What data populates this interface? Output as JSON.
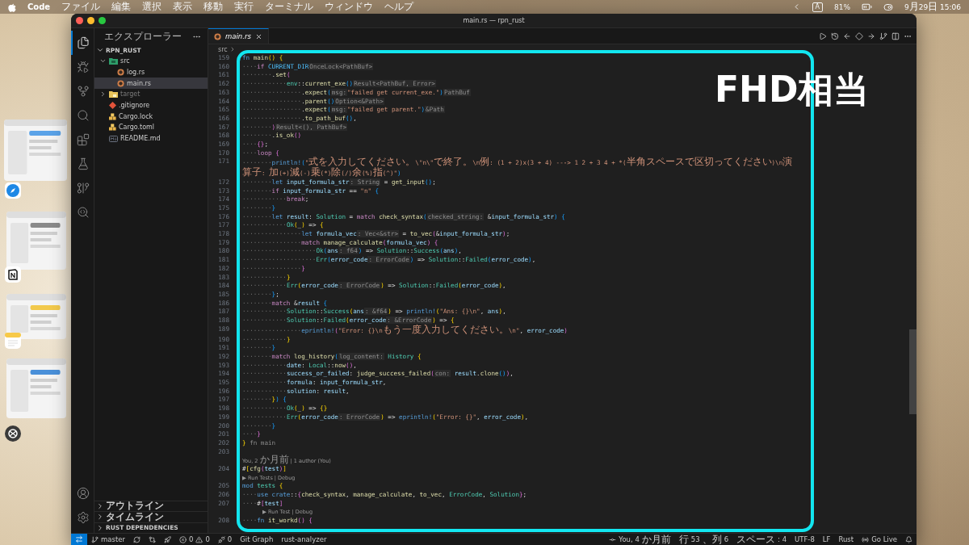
{
  "menubar": {
    "menus": [
      {
        "label": "Code",
        "bold": true
      },
      {
        "label": "ファイル",
        "bold": false
      },
      {
        "label": "編集",
        "bold": false
      },
      {
        "label": "選択",
        "bold": false
      },
      {
        "label": "表示",
        "bold": false
      },
      {
        "label": "移動",
        "bold": false
      },
      {
        "label": "実行",
        "bold": false
      },
      {
        "label": "ターミナル",
        "bold": false
      },
      {
        "label": "ウィンドウ",
        "bold": false
      },
      {
        "label": "ヘルプ",
        "bold": false
      }
    ],
    "input_source": "A",
    "battery": "81%",
    "clock": "9月29日 15:06"
  },
  "stage_manager": [
    {
      "kind": "safari"
    },
    {
      "kind": "notion"
    },
    {
      "kind": "notes"
    },
    {
      "kind": "chatgpt"
    }
  ],
  "window": {
    "title": "main.rs — rpn_rust"
  },
  "activity_bar": {
    "items": [
      {
        "kind": "explorer",
        "selected": true
      },
      {
        "kind": "run",
        "selected": false
      },
      {
        "kind": "scm",
        "selected": false
      },
      {
        "kind": "search",
        "selected": false
      },
      {
        "kind": "extensions",
        "selected": false
      },
      {
        "kind": "testing",
        "selected": false
      },
      {
        "kind": "gitgraph",
        "selected": false
      },
      {
        "kind": "remote",
        "selected": false
      }
    ],
    "bottom": [
      {
        "kind": "account"
      },
      {
        "kind": "settings"
      }
    ]
  },
  "explorer": {
    "title": "エクスプローラー",
    "root": {
      "label": "RPN_RUST",
      "expanded": true,
      "children": [
        {
          "label": "src",
          "kind": "src-folder",
          "expanded": true,
          "selected": false,
          "ignored": false,
          "children": [
            {
              "label": "log.rs",
              "kind": "rust",
              "selected": false,
              "ignored": false
            },
            {
              "label": "main.rs",
              "kind": "rust",
              "selected": true,
              "ignored": false
            }
          ]
        },
        {
          "label": "target",
          "kind": "folder",
          "expanded": false,
          "selected": false,
          "ignored": true
        },
        {
          "label": ".gitignore",
          "kind": "git",
          "selected": false,
          "ignored": false
        },
        {
          "label": "Cargo.lock",
          "kind": "cargo",
          "selected": false,
          "ignored": false
        },
        {
          "label": "Cargo.toml",
          "kind": "cargo",
          "selected": false,
          "ignored": false
        },
        {
          "label": "README.md",
          "kind": "markdown",
          "selected": false,
          "ignored": false
        }
      ]
    },
    "sections": [
      {
        "label": "アウトライン",
        "expanded": false
      },
      {
        "label": "タイムライン",
        "expanded": false
      },
      {
        "label": "RUST DEPENDENCIES",
        "expanded": false
      }
    ]
  },
  "tabs": [
    {
      "label": "main.rs",
      "selected": true,
      "preview": true
    }
  ],
  "editor_actions": [
    {
      "kind": "run"
    },
    {
      "kind": "history"
    },
    {
      "kind": "prev"
    },
    {
      "kind": "diamond"
    },
    {
      "kind": "next"
    },
    {
      "kind": "branch"
    },
    {
      "kind": "split"
    },
    {
      "kind": "more"
    }
  ],
  "breadcrumb": [
    "src"
  ],
  "annotation": {
    "label": "FHD相当"
  },
  "code": [
    {
      "kind": "code",
      "number": "159",
      "tokens": [
        {
          "kind": "kw",
          "text": "fn"
        },
        {
          "kind": "fn",
          "text": " main"
        },
        {
          "kind": "b1",
          "text": "()"
        },
        {
          "kind": "b1",
          "text": " {"
        }
      ]
    },
    {
      "kind": "code",
      "number": "160",
      "indent": "····",
      "tokens": [
        {
          "kind": "ctl",
          "text": "if"
        },
        {
          "kind": "const",
          "text": " CURRENT_DIR"
        },
        {
          "kind": "hint",
          "text": "OnceLock<PathBuf>"
        }
      ]
    },
    {
      "kind": "code",
      "number": "161",
      "indent": "········",
      "tokens": [
        {
          "kind": "p",
          "text": "."
        },
        {
          "kind": "fn",
          "text": "set"
        },
        {
          "kind": "b2",
          "text": "("
        }
      ]
    },
    {
      "kind": "code",
      "number": "162",
      "indent": "············",
      "tokens": [
        {
          "kind": "type",
          "text": "env"
        },
        {
          "kind": "p",
          "text": "::"
        },
        {
          "kind": "fn",
          "text": "current_exe"
        },
        {
          "kind": "b3",
          "text": "()"
        },
        {
          "kind": "hint",
          "text": "Result<PathBuf, Error>"
        }
      ]
    },
    {
      "kind": "code",
      "number": "163",
      "indent": "················",
      "tokens": [
        {
          "kind": "p",
          "text": "."
        },
        {
          "kind": "fn",
          "text": "expect"
        },
        {
          "kind": "b3",
          "text": "("
        },
        {
          "kind": "hint",
          "text": "msg:"
        },
        {
          "kind": "str",
          "text": "\"failed get current_exe.\""
        },
        {
          "kind": "b3",
          "text": ")"
        },
        {
          "kind": "hint",
          "text": "PathBuf"
        }
      ]
    },
    {
      "kind": "code",
      "number": "164",
      "indent": "················",
      "tokens": [
        {
          "kind": "p",
          "text": "."
        },
        {
          "kind": "fn",
          "text": "parent"
        },
        {
          "kind": "b3",
          "text": "()"
        },
        {
          "kind": "hint",
          "text": "Option<&Path>"
        }
      ]
    },
    {
      "kind": "code",
      "number": "165",
      "indent": "················",
      "tokens": [
        {
          "kind": "p",
          "text": "."
        },
        {
          "kind": "fn",
          "text": "expect"
        },
        {
          "kind": "b3",
          "text": "("
        },
        {
          "kind": "hint",
          "text": "msg:"
        },
        {
          "kind": "str",
          "text": "\"failed get parent.\""
        },
        {
          "kind": "b3",
          "text": ")"
        },
        {
          "kind": "hint",
          "text": "&Path"
        }
      ]
    },
    {
      "kind": "code",
      "number": "166",
      "indent": "················",
      "tokens": [
        {
          "kind": "p",
          "text": "."
        },
        {
          "kind": "fn",
          "text": "to_path_buf"
        },
        {
          "kind": "b3",
          "text": "()"
        },
        {
          "kind": "p",
          "text": ","
        }
      ]
    },
    {
      "kind": "code",
      "number": "167",
      "indent": "········",
      "tokens": [
        {
          "kind": "b2",
          "text": ")"
        },
        {
          "kind": "hint",
          "text": "Result<(), PathBuf>"
        }
      ]
    },
    {
      "kind": "code",
      "number": "168",
      "indent": "········",
      "tokens": [
        {
          "kind": "p",
          "text": "."
        },
        {
          "kind": "fn",
          "text": "is_ok"
        },
        {
          "kind": "b2",
          "text": "()"
        }
      ]
    },
    {
      "kind": "code",
      "number": "169",
      "indent": "····",
      "tokens": [
        {
          "kind": "b2",
          "text": "{}"
        },
        {
          "kind": "p",
          "text": ";"
        }
      ]
    },
    {
      "kind": "code",
      "number": "170",
      "indent": "····",
      "tokens": [
        {
          "kind": "ctl",
          "text": "loop"
        },
        {
          "kind": "b2",
          "text": " {"
        }
      ]
    },
    {
      "kind": "code",
      "number": "171",
      "indent": "········",
      "tokens": [
        {
          "kind": "mac",
          "text": "println!"
        },
        {
          "kind": "b3",
          "text": "("
        },
        {
          "kind": "str",
          "text": "\"式を入力してください。\\\"n\\\"で終了。\\n例: (1 + 2)x(3 + 4) ---> 1 2 + 3 4 + *(半角スペースで区切ってください)\\n演算子: 加(+)減(-)乗(*)除(/)余(%)指(^)\""
        },
        {
          "kind": "b3",
          "text": ")"
        }
      ]
    },
    {
      "kind": "code",
      "number": "172",
      "indent": "········",
      "tokens": [
        {
          "kind": "kw",
          "text": "let"
        },
        {
          "kind": "var",
          "text": " input_formula_str"
        },
        {
          "kind": "hint",
          "text": ": String"
        },
        {
          "kind": "p",
          "text": " = "
        },
        {
          "kind": "fn",
          "text": "get_input"
        },
        {
          "kind": "b3",
          "text": "()"
        },
        {
          "kind": "p",
          "text": ";"
        }
      ]
    },
    {
      "kind": "code",
      "number": "173",
      "indent": "········",
      "tokens": [
        {
          "kind": "ctl",
          "text": "if"
        },
        {
          "kind": "var",
          "text": " input_formula_str"
        },
        {
          "kind": "p",
          "text": " == "
        },
        {
          "kind": "str",
          "text": "\"n\""
        },
        {
          "kind": "b3",
          "text": " {"
        }
      ]
    },
    {
      "kind": "code",
      "number": "174",
      "indent": "············",
      "tokens": [
        {
          "kind": "ctl",
          "text": "break"
        },
        {
          "kind": "p",
          "text": ";"
        }
      ]
    },
    {
      "kind": "code",
      "number": "175",
      "indent": "········",
      "tokens": [
        {
          "kind": "b3",
          "text": "}"
        }
      ]
    },
    {
      "kind": "code",
      "number": "176",
      "indent": "········",
      "tokens": [
        {
          "kind": "kw",
          "text": "let"
        },
        {
          "kind": "var",
          "text": " result"
        },
        {
          "kind": "p",
          "text": ": "
        },
        {
          "kind": "type",
          "text": "Solution"
        },
        {
          "kind": "p",
          "text": " = "
        },
        {
          "kind": "ctl",
          "text": "match"
        },
        {
          "kind": "fn",
          "text": " check_syntax"
        },
        {
          "kind": "b3",
          "text": "("
        },
        {
          "kind": "hint",
          "text": "checked_string:"
        },
        {
          "kind": "p",
          "text": " &"
        },
        {
          "kind": "var",
          "text": "input_formula_str"
        },
        {
          "kind": "b3",
          "text": ")"
        },
        {
          "kind": "b3",
          "text": " {"
        }
      ]
    },
    {
      "kind": "code",
      "number": "177",
      "indent": "············",
      "tokens": [
        {
          "kind": "type",
          "text": "Ok"
        },
        {
          "kind": "b1",
          "text": "("
        },
        {
          "kind": "p",
          "text": "_"
        },
        {
          "kind": "b1",
          "text": ")"
        },
        {
          "kind": "p",
          "text": " => "
        },
        {
          "kind": "b1",
          "text": "{"
        }
      ]
    },
    {
      "kind": "code",
      "number": "178",
      "indent": "················",
      "tokens": [
        {
          "kind": "kw",
          "text": "let"
        },
        {
          "kind": "var",
          "text": " formula_vec"
        },
        {
          "kind": "hint",
          "text": ": Vec<&str>"
        },
        {
          "kind": "p",
          "text": " = "
        },
        {
          "kind": "fn",
          "text": "to_vec"
        },
        {
          "kind": "b2",
          "text": "("
        },
        {
          "kind": "p",
          "text": "&"
        },
        {
          "kind": "var",
          "text": "input_formula_str"
        },
        {
          "kind": "b2",
          "text": ")"
        },
        {
          "kind": "p",
          "text": ";"
        }
      ]
    },
    {
      "kind": "code",
      "number": "179",
      "indent": "················",
      "tokens": [
        {
          "kind": "ctl",
          "text": "match"
        },
        {
          "kind": "fn",
          "text": " manage_calculate"
        },
        {
          "kind": "b2",
          "text": "("
        },
        {
          "kind": "var",
          "text": "formula_vec"
        },
        {
          "kind": "b2",
          "text": ")"
        },
        {
          "kind": "b2",
          "text": " {"
        }
      ]
    },
    {
      "kind": "code",
      "number": "180",
      "indent": "····················",
      "tokens": [
        {
          "kind": "type",
          "text": "Ok"
        },
        {
          "kind": "b3",
          "text": "("
        },
        {
          "kind": "var",
          "text": "ans"
        },
        {
          "kind": "hint",
          "text": ": f64"
        },
        {
          "kind": "b3",
          "text": ")"
        },
        {
          "kind": "p",
          "text": " => "
        },
        {
          "kind": "type",
          "text": "Solution"
        },
        {
          "kind": "p",
          "text": "::"
        },
        {
          "kind": "type",
          "text": "Success"
        },
        {
          "kind": "b3",
          "text": "("
        },
        {
          "kind": "var",
          "text": "ans"
        },
        {
          "kind": "b3",
          "text": ")"
        },
        {
          "kind": "p",
          "text": ","
        }
      ]
    },
    {
      "kind": "code",
      "number": "181",
      "indent": "····················",
      "tokens": [
        {
          "kind": "type",
          "text": "Err"
        },
        {
          "kind": "b3",
          "text": "("
        },
        {
          "kind": "var",
          "text": "error_code"
        },
        {
          "kind": "hint",
          "text": ": ErrorCode"
        },
        {
          "kind": "b3",
          "text": ")"
        },
        {
          "kind": "p",
          "text": " => "
        },
        {
          "kind": "type",
          "text": "Solution"
        },
        {
          "kind": "p",
          "text": "::"
        },
        {
          "kind": "type",
          "text": "Failed"
        },
        {
          "kind": "b3",
          "text": "("
        },
        {
          "kind": "var",
          "text": "error_code"
        },
        {
          "kind": "b3",
          "text": ")"
        },
        {
          "kind": "p",
          "text": ","
        }
      ]
    },
    {
      "kind": "code",
      "number": "182",
      "indent": "················",
      "tokens": [
        {
          "kind": "b2",
          "text": "}"
        }
      ]
    },
    {
      "kind": "code",
      "number": "183",
      "indent": "············",
      "tokens": [
        {
          "kind": "b1",
          "text": "}"
        }
      ]
    },
    {
      "kind": "code",
      "number": "184",
      "indent": "············",
      "tokens": [
        {
          "kind": "type",
          "text": "Err"
        },
        {
          "kind": "b1",
          "text": "("
        },
        {
          "kind": "var",
          "text": "error_code"
        },
        {
          "kind": "hint",
          "text": ": ErrorCode"
        },
        {
          "kind": "b1",
          "text": ")"
        },
        {
          "kind": "p",
          "text": " => "
        },
        {
          "kind": "type",
          "text": "Solution"
        },
        {
          "kind": "p",
          "text": "::"
        },
        {
          "kind": "type",
          "text": "Failed"
        },
        {
          "kind": "b1",
          "text": "("
        },
        {
          "kind": "var",
          "text": "error_code"
        },
        {
          "kind": "b1",
          "text": ")"
        },
        {
          "kind": "p",
          "text": ","
        }
      ]
    },
    {
      "kind": "code",
      "number": "185",
      "indent": "········",
      "tokens": [
        {
          "kind": "b3",
          "text": "}"
        },
        {
          "kind": "p",
          "text": ";"
        }
      ]
    },
    {
      "kind": "code",
      "number": "186",
      "indent": "········",
      "tokens": [
        {
          "kind": "ctl",
          "text": "match"
        },
        {
          "kind": "p",
          "text": " &"
        },
        {
          "kind": "var",
          "text": "result"
        },
        {
          "kind": "b3",
          "text": " {"
        }
      ]
    },
    {
      "kind": "code",
      "number": "187",
      "indent": "············",
      "tokens": [
        {
          "kind": "type",
          "text": "Solution"
        },
        {
          "kind": "p",
          "text": "::"
        },
        {
          "kind": "type",
          "text": "Success"
        },
        {
          "kind": "b1",
          "text": "("
        },
        {
          "kind": "var",
          "text": "ans"
        },
        {
          "kind": "hint",
          "text": ": &f64"
        },
        {
          "kind": "b1",
          "text": ")"
        },
        {
          "kind": "p",
          "text": " => "
        },
        {
          "kind": "mac",
          "text": "println!"
        },
        {
          "kind": "b1",
          "text": "("
        },
        {
          "kind": "str",
          "text": "\"Ans: {}\\n\""
        },
        {
          "kind": "p",
          "text": ", "
        },
        {
          "kind": "var",
          "text": "ans"
        },
        {
          "kind": "b1",
          "text": ")"
        },
        {
          "kind": "p",
          "text": ","
        }
      ]
    },
    {
      "kind": "code",
      "number": "188",
      "indent": "············",
      "tokens": [
        {
          "kind": "type",
          "text": "Solution"
        },
        {
          "kind": "p",
          "text": "::"
        },
        {
          "kind": "type",
          "text": "Failed"
        },
        {
          "kind": "b1",
          "text": "("
        },
        {
          "kind": "var",
          "text": "error_code"
        },
        {
          "kind": "hint",
          "text": ": &ErrorCode"
        },
        {
          "kind": "b1",
          "text": ")"
        },
        {
          "kind": "p",
          "text": " => "
        },
        {
          "kind": "b1",
          "text": "{"
        }
      ]
    },
    {
      "kind": "code",
      "number": "189",
      "indent": "················",
      "tokens": [
        {
          "kind": "mac",
          "text": "eprintln!"
        },
        {
          "kind": "b2",
          "text": "("
        },
        {
          "kind": "str",
          "text": "\"Error: {}\\nもう一度入力してください。\\n\""
        },
        {
          "kind": "p",
          "text": ", "
        },
        {
          "kind": "var",
          "text": "error_code"
        },
        {
          "kind": "b2",
          "text": ")"
        }
      ]
    },
    {
      "kind": "code",
      "number": "190",
      "indent": "············",
      "tokens": [
        {
          "kind": "b1",
          "text": "}"
        }
      ]
    },
    {
      "kind": "code",
      "number": "191",
      "indent": "········",
      "tokens": [
        {
          "kind": "b3",
          "text": "}"
        }
      ]
    },
    {
      "kind": "code",
      "number": "192",
      "indent": "········",
      "tokens": [
        {
          "kind": "ctl",
          "text": "match"
        },
        {
          "kind": "fn",
          "text": " log_history"
        },
        {
          "kind": "b3",
          "text": "("
        },
        {
          "kind": "hint",
          "text": "log_content:"
        },
        {
          "kind": "type",
          "text": " History"
        },
        {
          "kind": "b1",
          "text": " {"
        }
      ]
    },
    {
      "kind": "code",
      "number": "193",
      "indent": "············",
      "tokens": [
        {
          "kind": "var",
          "text": "date"
        },
        {
          "kind": "p",
          "text": ": "
        },
        {
          "kind": "type",
          "text": "Local"
        },
        {
          "kind": "p",
          "text": "::"
        },
        {
          "kind": "fn",
          "text": "now"
        },
        {
          "kind": "b2",
          "text": "()"
        },
        {
          "kind": "p",
          "text": ","
        }
      ]
    },
    {
      "kind": "code",
      "number": "194",
      "indent": "············",
      "tokens": [
        {
          "kind": "var",
          "text": "success_or_failed"
        },
        {
          "kind": "p",
          "text": ": "
        },
        {
          "kind": "fn",
          "text": "judge_success_failed"
        },
        {
          "kind": "b2",
          "text": "("
        },
        {
          "kind": "hint",
          "text": "con:"
        },
        {
          "kind": "var",
          "text": " result"
        },
        {
          "kind": "p",
          "text": "."
        },
        {
          "kind": "fn",
          "text": "clone"
        },
        {
          "kind": "b3",
          "text": "()"
        },
        {
          "kind": "b2",
          "text": ")"
        },
        {
          "kind": "p",
          "text": ","
        }
      ]
    },
    {
      "kind": "code",
      "number": "195",
      "indent": "············",
      "tokens": [
        {
          "kind": "var",
          "text": "formula"
        },
        {
          "kind": "p",
          "text": ": "
        },
        {
          "kind": "var",
          "text": "input_formula_str"
        },
        {
          "kind": "p",
          "text": ","
        }
      ]
    },
    {
      "kind": "code",
      "number": "196",
      "indent": "············",
      "tokens": [
        {
          "kind": "var",
          "text": "solution"
        },
        {
          "kind": "p",
          "text": ": "
        },
        {
          "kind": "var",
          "text": "result"
        },
        {
          "kind": "p",
          "text": ","
        }
      ]
    },
    {
      "kind": "code",
      "number": "197",
      "indent": "········",
      "tokens": [
        {
          "kind": "b1",
          "text": "}"
        },
        {
          "kind": "b3",
          "text": ")"
        },
        {
          "kind": "b3",
          "text": " {"
        }
      ]
    },
    {
      "kind": "code",
      "number": "198",
      "indent": "············",
      "tokens": [
        {
          "kind": "type",
          "text": "Ok"
        },
        {
          "kind": "b1",
          "text": "("
        },
        {
          "kind": "p",
          "text": "_"
        },
        {
          "kind": "b1",
          "text": ")"
        },
        {
          "kind": "p",
          "text": " => "
        },
        {
          "kind": "b1",
          "text": "{}"
        }
      ]
    },
    {
      "kind": "code",
      "number": "199",
      "indent": "············",
      "tokens": [
        {
          "kind": "type",
          "text": "Err"
        },
        {
          "kind": "b1",
          "text": "("
        },
        {
          "kind": "var",
          "text": "error_code"
        },
        {
          "kind": "hint",
          "text": ": ErrorCode"
        },
        {
          "kind": "b1",
          "text": ")"
        },
        {
          "kind": "p",
          "text": " => "
        },
        {
          "kind": "mac",
          "text": "eprintln!"
        },
        {
          "kind": "b1",
          "text": "("
        },
        {
          "kind": "str",
          "text": "\"Error: {}\""
        },
        {
          "kind": "p",
          "text": ", "
        },
        {
          "kind": "var",
          "text": "error_code"
        },
        {
          "kind": "b1",
          "text": ")"
        },
        {
          "kind": "p",
          "text": ","
        }
      ]
    },
    {
      "kind": "code",
      "number": "200",
      "indent": "········",
      "tokens": [
        {
          "kind": "b3",
          "text": "}"
        }
      ]
    },
    {
      "kind": "code",
      "number": "201",
      "indent": "····",
      "tokens": [
        {
          "kind": "b2",
          "text": "}"
        }
      ]
    },
    {
      "kind": "code",
      "number": "202",
      "tokens": [
        {
          "kind": "b1",
          "text": "}"
        },
        {
          "kind": "ghost",
          "text": " fn main"
        }
      ]
    },
    {
      "kind": "code",
      "number": "203"
    },
    {
      "kind": "lens",
      "text": "You, 2 か月前 | 1 author (You)",
      "indented": false
    },
    {
      "kind": "code",
      "number": "204",
      "tokens": [
        {
          "kind": "p",
          "text": "#"
        },
        {
          "kind": "b1",
          "text": "["
        },
        {
          "kind": "fn",
          "text": "cfg"
        },
        {
          "kind": "b2",
          "text": "("
        },
        {
          "kind": "var",
          "text": "test"
        },
        {
          "kind": "b2",
          "text": ")"
        },
        {
          "kind": "b1",
          "text": "]"
        }
      ]
    },
    {
      "kind": "lens",
      "text": "▶ Run Tests | Debug",
      "indented": false
    },
    {
      "kind": "code",
      "number": "205",
      "tokens": [
        {
          "kind": "kw",
          "text": "mod"
        },
        {
          "kind": "type",
          "text": " tests"
        },
        {
          "kind": "b1",
          "text": " {"
        }
      ]
    },
    {
      "kind": "code",
      "number": "206",
      "indent": "····",
      "tokens": [
        {
          "kind": "kw",
          "text": "use"
        },
        {
          "kind": "kw",
          "text": " crate"
        },
        {
          "kind": "p",
          "text": "::"
        },
        {
          "kind": "b2",
          "text": "{"
        },
        {
          "kind": "fn",
          "text": "check_syntax"
        },
        {
          "kind": "p",
          "text": ", "
        },
        {
          "kind": "fn",
          "text": "manage_calculate"
        },
        {
          "kind": "p",
          "text": ", "
        },
        {
          "kind": "fn",
          "text": "to_vec"
        },
        {
          "kind": "p",
          "text": ", "
        },
        {
          "kind": "type",
          "text": "ErrorCode"
        },
        {
          "kind": "p",
          "text": ", "
        },
        {
          "kind": "type",
          "text": "Solution"
        },
        {
          "kind": "b2",
          "text": "}"
        },
        {
          "kind": "p",
          "text": ";"
        }
      ]
    },
    {
      "kind": "code",
      "number": "207",
      "indent": "····",
      "tokens": [
        {
          "kind": "p",
          "text": "#"
        },
        {
          "kind": "b2",
          "text": "["
        },
        {
          "kind": "var",
          "text": "test"
        },
        {
          "kind": "b2",
          "text": "]"
        }
      ]
    },
    {
      "kind": "lens",
      "text": "▶ Run Test | Debug",
      "indented": true
    },
    {
      "kind": "code",
      "number": "208",
      "indent": "····",
      "tokens": [
        {
          "kind": "kw",
          "text": "fn"
        },
        {
          "kind": "fn",
          "text": " it_workd"
        },
        {
          "kind": "b2",
          "text": "()"
        },
        {
          "kind": "b2",
          "text": " {"
        }
      ]
    }
  ],
  "status_bar": {
    "left": [
      {
        "kind": "remote"
      },
      {
        "kind": "branch",
        "text": "master"
      },
      {
        "kind": "sync"
      },
      {
        "kind": "compare"
      },
      {
        "kind": "rocket"
      },
      {
        "kind": "problems",
        "errors": "0",
        "warnings": "0"
      },
      {
        "kind": "ports",
        "text": "0"
      },
      {
        "kind": "text",
        "text": "Git Graph"
      },
      {
        "kind": "text",
        "text": "rust-analyzer"
      }
    ],
    "right": [
      {
        "kind": "blame",
        "text": "You, 4 か月前"
      },
      {
        "kind": "text",
        "text": "行 53、列 6"
      },
      {
        "kind": "text",
        "text": "スペース: 4"
      },
      {
        "kind": "text",
        "text": "UTF-8"
      },
      {
        "kind": "text",
        "text": "LF"
      },
      {
        "kind": "text",
        "text": "Rust"
      },
      {
        "kind": "golive",
        "text": "Go Live"
      },
      {
        "kind": "bell"
      }
    ]
  }
}
